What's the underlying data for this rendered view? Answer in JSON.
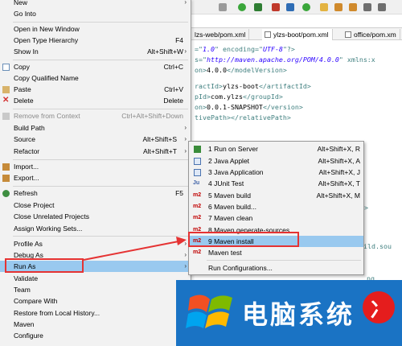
{
  "editor": {
    "tabs": [
      {
        "label": "lzs-web/pom.xml",
        "active": false
      },
      {
        "label": "ylzs-boot/pom.xml",
        "active": true
      },
      {
        "label": "office/pom.xm",
        "active": false
      }
    ],
    "code": [
      {
        "a": "=\"",
        "b": "1.0",
        "c": "\" encoding=\"",
        "d": "UTF-8",
        "e": "\"?>"
      },
      {
        "a": "s=\"",
        "b": "http://maven.apache.org/POM/4.0.0",
        "c": "\" xmlns:x",
        "d": "",
        "e": ""
      },
      {
        "a": "on>",
        "b": "4.0.0",
        "c": "</modelVersion>",
        "d": "",
        "e": ""
      },
      {
        "a": "ractId>",
        "b": "ylzs-boot",
        "c": "</artifactId>",
        "d": "",
        "e": ""
      },
      {
        "a": "pId>",
        "b": "com.ylzs",
        "c": "</groupId>",
        "d": "",
        "e": ""
      },
      {
        "a": "on>",
        "b": "0.0.1-SNAPSHOT",
        "c": "</version>",
        "d": "",
        "e": ""
      },
      {
        "a": "tivePath></relativePath>",
        "b": "",
        "c": "",
        "d": "",
        "e": ""
      }
    ],
    "frag1": ">",
    "frag2": "ild.sou",
    "frag3": "ng"
  },
  "menu": {
    "items": [
      {
        "label": "New",
        "shortcut": "",
        "submenu": true,
        "disabled": false
      },
      {
        "label": "Go Into",
        "shortcut": "",
        "submenu": false,
        "disabled": false
      },
      {
        "label": "Open in New Window",
        "shortcut": "",
        "submenu": false,
        "disabled": false
      },
      {
        "label": "Open Type Hierarchy",
        "shortcut": "F4",
        "submenu": false,
        "disabled": false
      },
      {
        "label": "Show In",
        "shortcut": "Alt+Shift+W",
        "submenu": true,
        "disabled": false
      },
      {
        "label": "Copy",
        "shortcut": "Ctrl+C",
        "submenu": false,
        "disabled": false
      },
      {
        "label": "Copy Qualified Name",
        "shortcut": "",
        "submenu": false,
        "disabled": false
      },
      {
        "label": "Paste",
        "shortcut": "Ctrl+V",
        "submenu": false,
        "disabled": false
      },
      {
        "label": "Delete",
        "shortcut": "Delete",
        "submenu": false,
        "disabled": false
      },
      {
        "label": "Remove from Context",
        "shortcut": "Ctrl+Alt+Shift+Down",
        "submenu": false,
        "disabled": true
      },
      {
        "label": "Build Path",
        "shortcut": "",
        "submenu": true,
        "disabled": false
      },
      {
        "label": "Source",
        "shortcut": "Alt+Shift+S",
        "submenu": true,
        "disabled": false
      },
      {
        "label": "Refactor",
        "shortcut": "Alt+Shift+T",
        "submenu": true,
        "disabled": false
      },
      {
        "label": "Import...",
        "shortcut": "",
        "submenu": false,
        "disabled": false
      },
      {
        "label": "Export...",
        "shortcut": "",
        "submenu": false,
        "disabled": false
      },
      {
        "label": "Refresh",
        "shortcut": "F5",
        "submenu": false,
        "disabled": false
      },
      {
        "label": "Close Project",
        "shortcut": "",
        "submenu": false,
        "disabled": false
      },
      {
        "label": "Close Unrelated Projects",
        "shortcut": "",
        "submenu": false,
        "disabled": false
      },
      {
        "label": "Assign Working Sets...",
        "shortcut": "",
        "submenu": false,
        "disabled": false
      },
      {
        "label": "Profile As",
        "shortcut": "",
        "submenu": true,
        "disabled": false
      },
      {
        "label": "Debug As",
        "shortcut": "",
        "submenu": true,
        "disabled": false
      },
      {
        "label": "Run As",
        "shortcut": "",
        "submenu": true,
        "disabled": false
      },
      {
        "label": "Validate",
        "shortcut": "",
        "submenu": false,
        "disabled": false
      },
      {
        "label": "Team",
        "shortcut": "",
        "submenu": true,
        "disabled": false
      },
      {
        "label": "Compare With",
        "shortcut": "",
        "submenu": true,
        "disabled": false
      },
      {
        "label": "Restore from Local History...",
        "shortcut": "",
        "submenu": false,
        "disabled": false
      },
      {
        "label": "Maven",
        "shortcut": "",
        "submenu": true,
        "disabled": false
      },
      {
        "label": "Configure",
        "shortcut": "",
        "submenu": true,
        "disabled": false
      }
    ]
  },
  "submenu": {
    "items": [
      {
        "label": "1 Run on Server",
        "shortcut": "Alt+Shift+X, R",
        "icon": "server-icon"
      },
      {
        "label": "2 Java Applet",
        "shortcut": "Alt+Shift+X, A",
        "icon": "applet-icon"
      },
      {
        "label": "3 Java Application",
        "shortcut": "Alt+Shift+X, J",
        "icon": "java-app-icon"
      },
      {
        "label": "4 JUnit Test",
        "shortcut": "Alt+Shift+X, T",
        "icon": "junit-icon"
      },
      {
        "label": "5 Maven build",
        "shortcut": "Alt+Shift+X, M",
        "icon": "m2"
      },
      {
        "label": "6 Maven build...",
        "shortcut": "",
        "icon": "m2"
      },
      {
        "label": "7 Maven clean",
        "shortcut": "",
        "icon": "m2"
      },
      {
        "label": "8 Maven generate-sources",
        "shortcut": "",
        "icon": "m2"
      },
      {
        "label": "9 Maven install",
        "shortcut": "",
        "icon": "m2"
      },
      {
        "label": "Maven test",
        "shortcut": "",
        "icon": "m2"
      },
      {
        "label": "Run Configurations...",
        "shortcut": "",
        "icon": ""
      }
    ],
    "m2_label": "m2"
  },
  "watermark": {
    "text": "电脑系统",
    "badge": "冫"
  },
  "colors": {
    "highlight": "#99c9ef",
    "annotation_red": "#e53333",
    "watermark_blue": "#1a73c4"
  }
}
